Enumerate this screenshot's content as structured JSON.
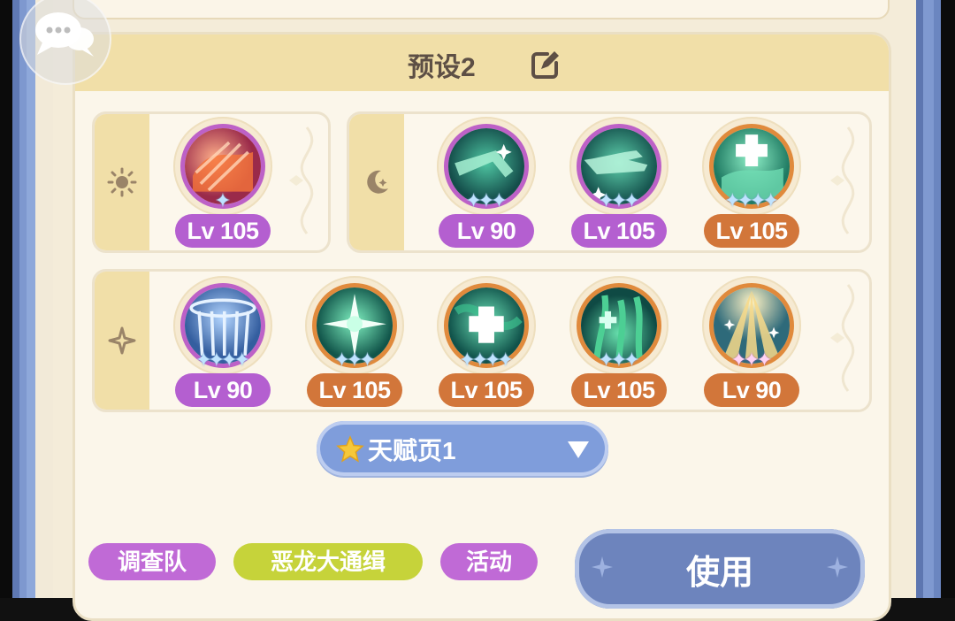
{
  "preset": {
    "title": "预设2"
  },
  "rows": [
    {
      "id": "sun",
      "icon": "sun-icon",
      "skills": [
        {
          "level": "Lv 105",
          "badge": "purple",
          "stars": 1,
          "star_color": "blue",
          "art": "red-flame"
        }
      ]
    },
    {
      "id": "moon",
      "icon": "moon-icon",
      "skills": [
        {
          "level": "Lv 90",
          "badge": "purple",
          "stars": 3,
          "star_color": "blue",
          "art": "green-arm"
        },
        {
          "level": "Lv 105",
          "badge": "purple",
          "stars": 3,
          "star_color": "blue",
          "art": "green-hands"
        },
        {
          "level": "Lv 105",
          "badge": "orange",
          "stars": 4,
          "star_color": "blue",
          "art": "green-cross"
        }
      ]
    },
    {
      "id": "star",
      "icon": "sparkle-icon",
      "skills": [
        {
          "level": "Lv 90",
          "badge": "purple",
          "stars": 4,
          "star_color": "blue",
          "art": "blue-rain"
        },
        {
          "level": "Lv 105",
          "badge": "orange",
          "stars": 3,
          "star_color": "blue",
          "art": "green-star"
        },
        {
          "level": "Lv 105",
          "badge": "orange",
          "stars": 4,
          "star_color": "blue",
          "art": "green-heal"
        },
        {
          "level": "Lv 105",
          "badge": "orange",
          "stars": 3,
          "star_color": "blue",
          "art": "green-rise"
        },
        {
          "level": "Lv 90",
          "badge": "orange",
          "stars": 3,
          "star_color": "pink",
          "art": "gold-burst"
        }
      ]
    }
  ],
  "talent": {
    "label": "天赋页1"
  },
  "tags": {
    "survey": "调查队",
    "dragon": "恶龙大通缉",
    "event": "活动"
  },
  "use_button": {
    "label": "使用"
  },
  "colors": {
    "purple_badge": "#b45fd0",
    "orange_badge": "#d2763a",
    "use_button": "#6d84bd",
    "talent_select": "#7f9ddb",
    "header": "#f1dfa8",
    "dragon_tag": "#c6d33a"
  }
}
